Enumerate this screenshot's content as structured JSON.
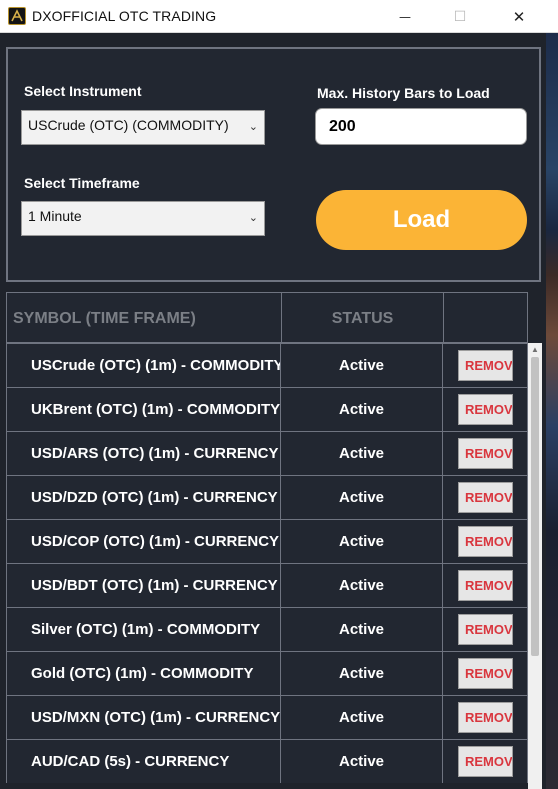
{
  "window": {
    "title": "DXOFFICIAL OTC TRADING",
    "minimize_glyph": "—",
    "maximize_glyph": "☐",
    "close_glyph": "✕",
    "icon": "dx-logo-icon"
  },
  "controls": {
    "instrument_label": "Select Instrument",
    "instrument_value": "USCrude (OTC) (COMMODITY)",
    "timeframe_label": "Select Timeframe",
    "timeframe_value": "1 Minute",
    "history_label": "Max. History Bars to Load",
    "history_value": "200",
    "load_label": "Load",
    "chevron_glyph": "⌄"
  },
  "table": {
    "headers": [
      "SYMBOL (TIME FRAME)",
      "STATUS",
      ""
    ],
    "remove_label": "REMOVE",
    "rows": [
      {
        "symbol": "USCrude (OTC) (1m) - COMMODITY",
        "status": "Active"
      },
      {
        "symbol": "UKBrent (OTC) (1m) - COMMODITY",
        "status": "Active"
      },
      {
        "symbol": "USD/ARS (OTC) (1m) - CURRENCY",
        "status": "Active"
      },
      {
        "symbol": "USD/DZD (OTC) (1m) - CURRENCY",
        "status": "Active"
      },
      {
        "symbol": "USD/COP (OTC) (1m) - CURRENCY",
        "status": "Active"
      },
      {
        "symbol": "USD/BDT (OTC) (1m) - CURRENCY",
        "status": "Active"
      },
      {
        "symbol": "Silver (OTC) (1m) - COMMODITY",
        "status": "Active"
      },
      {
        "symbol": "Gold (OTC) (1m) - COMMODITY",
        "status": "Active"
      },
      {
        "symbol": "USD/MXN (OTC) (1m) - CURRENCY",
        "status": "Active"
      },
      {
        "symbol": "AUD/CAD (5s) - CURRENCY",
        "status": "Active"
      }
    ]
  },
  "colors": {
    "background": "#1f232b",
    "load_button": "#fbb436",
    "remove_text": "#d9363e",
    "header_text": "#7b7f86"
  }
}
